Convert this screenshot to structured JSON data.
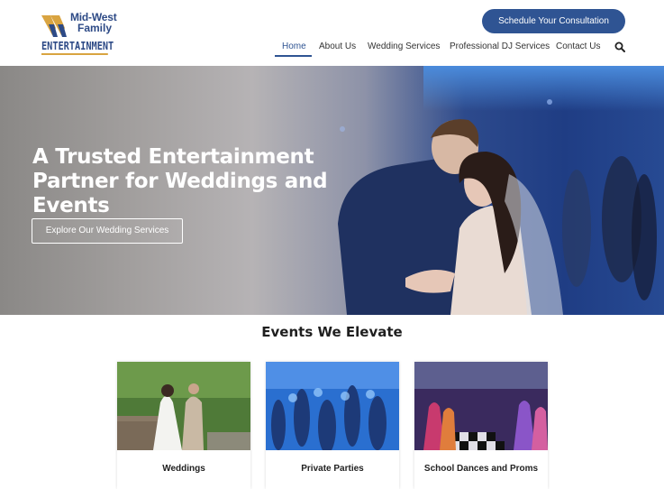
{
  "brand": {
    "line1": "Mid-West",
    "line2": "Family",
    "wordmark": "ENTERTAINMENT",
    "primary_color": "#2f5493",
    "accent_color": "#d9a441"
  },
  "header": {
    "cta_label": "Schedule Your Consultation",
    "nav": [
      {
        "label": "Home",
        "active": true
      },
      {
        "label": "About Us",
        "active": false
      },
      {
        "label": "Wedding Services",
        "active": false
      },
      {
        "label": "Professional DJ Services",
        "active": false
      },
      {
        "label": "Contact Us",
        "active": false
      }
    ],
    "search_icon": "search-icon"
  },
  "hero": {
    "title": "A Trusted Entertainment Partner for Weddings and Events",
    "button_label": "Explore Our Wedding Services"
  },
  "events": {
    "title": "Events We Elevate",
    "cards": [
      {
        "label": "Weddings"
      },
      {
        "label": "Private Parties"
      },
      {
        "label": "School Dances and Proms"
      }
    ]
  }
}
